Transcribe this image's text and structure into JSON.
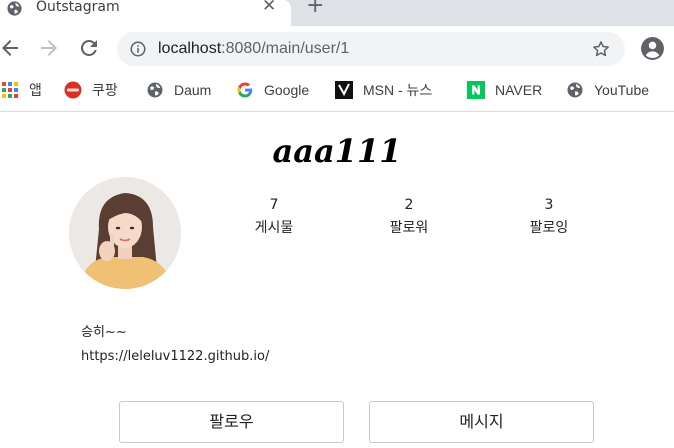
{
  "browser": {
    "tab": {
      "title": "Outstagram",
      "close_glyph": "✕",
      "icon": "globe-icon"
    },
    "new_tab_glyph": "+",
    "url_host": "localhost",
    "url_path": ":8080/main/user/1",
    "bookmarks": [
      {
        "label": "앱",
        "icon": "apps-grid-icon"
      },
      {
        "label": "쿠팡",
        "icon": "coupang-icon"
      },
      {
        "label": "Daum",
        "icon": "globe-icon"
      },
      {
        "label": "Google",
        "icon": "google-icon"
      },
      {
        "label": "MSN - 뉴스",
        "icon": "msn-icon"
      },
      {
        "label": "NAVER",
        "icon": "naver-icon"
      },
      {
        "label": "YouTube",
        "icon": "globe-icon"
      }
    ]
  },
  "profile": {
    "username": "aaa111",
    "stats": [
      {
        "value": "7",
        "label": "게시물"
      },
      {
        "value": "2",
        "label": "팔로워"
      },
      {
        "value": "3",
        "label": "팔로잉"
      }
    ],
    "bio_name": "승히~~",
    "bio_link": "https://leleluv1122.github.io/",
    "follow_label": "팔로우",
    "message_label": "메시지"
  },
  "colors": {
    "naver_green": "#03c75a",
    "google_blue": "#4285f4",
    "icon_gray": "#5f6368"
  }
}
